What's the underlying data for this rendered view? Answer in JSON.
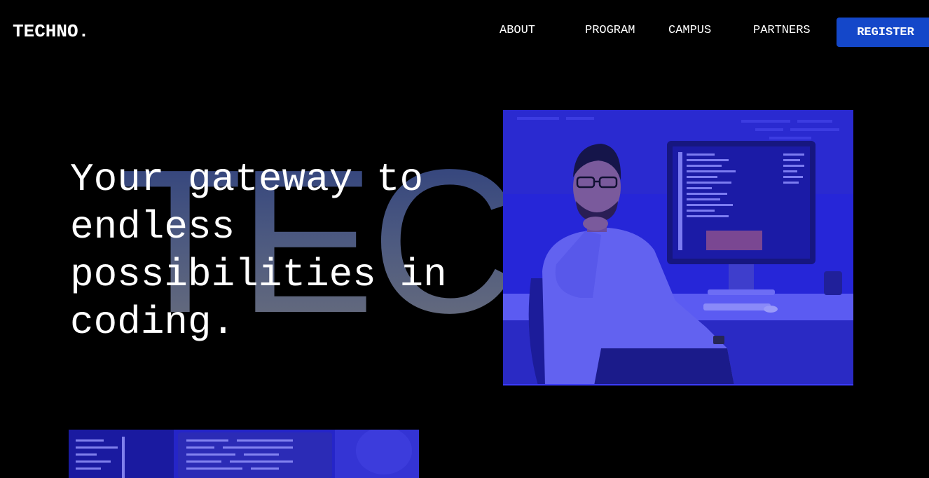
{
  "header": {
    "logo": "TECHNO.",
    "nav": {
      "about": "ABOUT",
      "program": "PROGRAM",
      "campus": "CAMPUS",
      "partners": "PARTNERS"
    },
    "register_label": "REGISTER"
  },
  "hero": {
    "watermark": "TEC",
    "headline": "Your gateway to endless possibilities in coding."
  },
  "colors": {
    "background": "#000000",
    "accent": "#1447c9",
    "image_tint": "#2424d6"
  }
}
